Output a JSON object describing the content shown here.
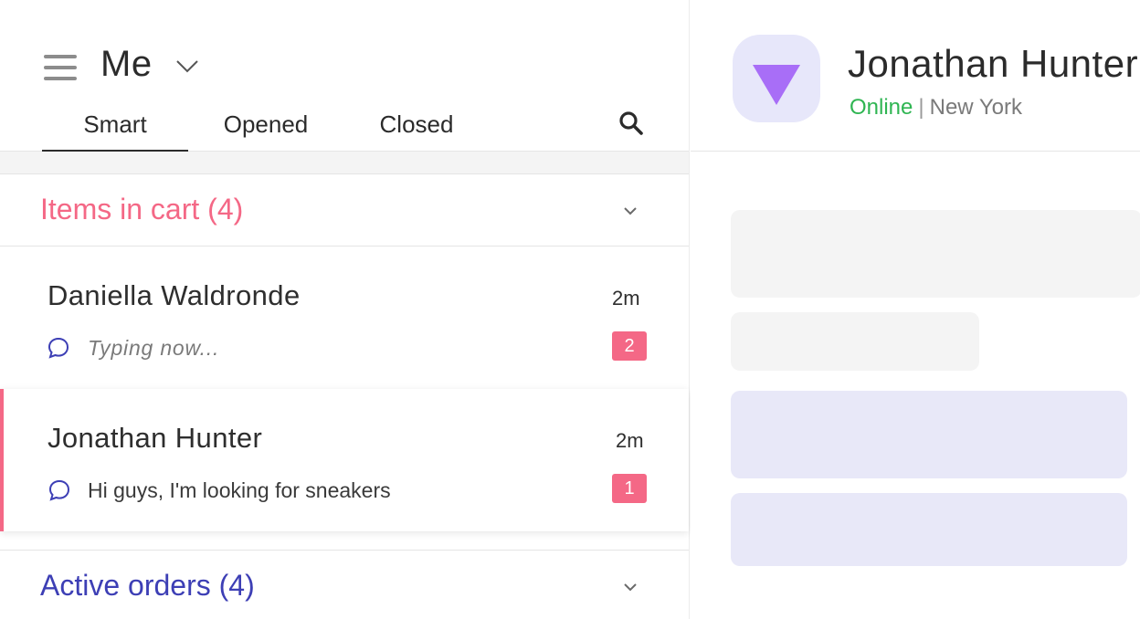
{
  "inbox": {
    "title": "Me",
    "tabs": [
      {
        "label": "Smart",
        "active": true
      },
      {
        "label": "Opened",
        "active": false
      },
      {
        "label": "Closed",
        "active": false
      }
    ]
  },
  "sections": {
    "cart": {
      "title": "Items in cart (4)",
      "color": "#f46886"
    },
    "orders": {
      "title": "Active orders (4)",
      "color": "#3d3fb5"
    }
  },
  "conversations": [
    {
      "name": "Daniella Waldronde",
      "time": "2m",
      "preview": "Typing now...",
      "unread": "2",
      "selected": false
    },
    {
      "name": "Jonathan Hunter",
      "time": "2m",
      "preview": "Hi guys, I'm looking for sneakers",
      "unread": "1",
      "selected": true
    }
  ],
  "contact": {
    "name": "Jonathan Hunter",
    "status": "Online",
    "separator": "|",
    "location": "New York"
  },
  "icons": {
    "menu": "hamburger-icon",
    "dropdown": "chevron-down-icon",
    "search": "search-icon",
    "chat": "chat-bubble-icon",
    "avatar": "triangle-down-icon"
  },
  "colors": {
    "accent_pink": "#f46886",
    "accent_indigo": "#3d3fb5",
    "online_green": "#2fb552",
    "avatar_bg": "#e7e7fa",
    "avatar_shape": "#a86ef7"
  }
}
